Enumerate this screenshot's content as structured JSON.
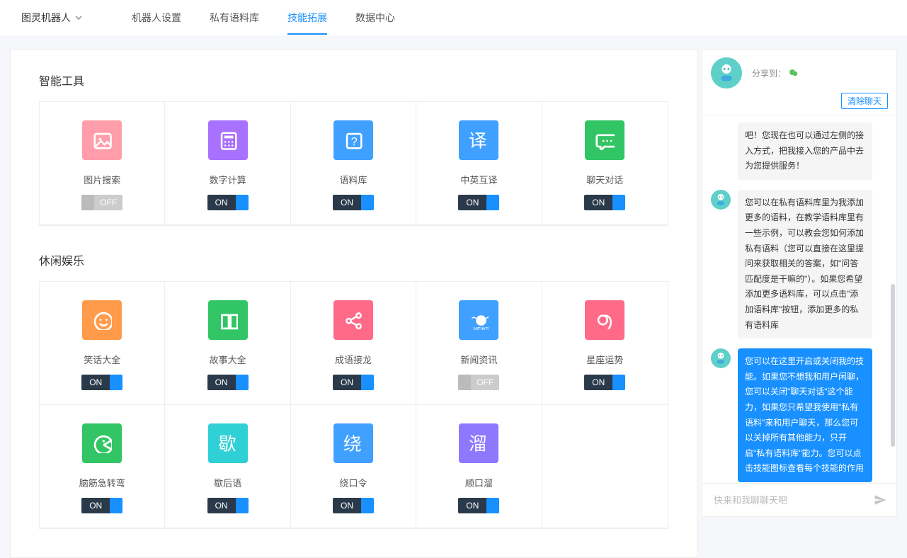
{
  "header": {
    "brand": "图灵机器人",
    "nav": [
      {
        "label": "机器人设置",
        "active": false
      },
      {
        "label": "私有语料库",
        "active": false
      },
      {
        "label": "技能拓展",
        "active": true
      },
      {
        "label": "数据中心",
        "active": false
      }
    ]
  },
  "toggle_labels": {
    "on": "ON",
    "off": "OFF"
  },
  "sections": {
    "tools": {
      "title": "智能工具",
      "items": [
        {
          "name": "image-search",
          "label": "图片搜索",
          "on": false,
          "color": "#ff9eaa",
          "icon": "image"
        },
        {
          "name": "number-calc",
          "label": "数字计算",
          "on": true,
          "color": "#a971ff",
          "icon": "calc"
        },
        {
          "name": "corpus",
          "label": "语料库",
          "on": true,
          "color": "#3fa0ff",
          "icon": "question"
        },
        {
          "name": "translate",
          "label": "中英互译",
          "on": true,
          "color": "#3fa0ff",
          "icon": "translate"
        },
        {
          "name": "chat",
          "label": "聊天对话",
          "on": true,
          "color": "#32c565",
          "icon": "chat"
        }
      ]
    },
    "fun": {
      "title": "休闲娱乐",
      "items": [
        {
          "name": "jokes",
          "label": "笑话大全",
          "on": true,
          "color": "#ff9b4a",
          "icon": "smile"
        },
        {
          "name": "stories",
          "label": "故事大全",
          "on": true,
          "color": "#32c565",
          "icon": "book"
        },
        {
          "name": "idiom",
          "label": "成语接龙",
          "on": true,
          "color": "#ff6a88",
          "icon": "share"
        },
        {
          "name": "news",
          "label": "新闻资讯",
          "on": false,
          "color": "#3fa0ff",
          "icon": "news"
        },
        {
          "name": "horoscope",
          "label": "星座运势",
          "on": true,
          "color": "#ff6a88",
          "icon": "zodiac"
        },
        {
          "name": "brain",
          "label": "脑筋急转弯",
          "on": true,
          "color": "#32c565",
          "icon": "pac"
        },
        {
          "name": "xiehouyu",
          "label": "歇后语",
          "on": true,
          "color": "#2fd0d6",
          "icon": "xie"
        },
        {
          "name": "tongue1",
          "label": "绕口令",
          "on": true,
          "color": "#3fa0ff",
          "icon": "rao"
        },
        {
          "name": "tongue2",
          "label": "顺口溜",
          "on": true,
          "color": "#8e78ff",
          "icon": "liu"
        }
      ]
    }
  },
  "chat": {
    "share_label": "分享到：",
    "clear_label": "清除聊天",
    "input_placeholder": "快来和我聊聊天吧",
    "messages": [
      {
        "type": "partial",
        "text": "吧！您现在也可以通过左侧的接入方式，把我接入您的产品中去为您提供服务！",
        "style": "plain",
        "avatar": false
      },
      {
        "type": "full",
        "text": "您可以在私有语料库里为我添加更多的语料，在教学语料库里有一些示例，可以教会您如何添加私有语料（您可以直接在这里提问来获取相关的答案，如\"问答匹配度是干嘛的\"）。如果您希望添加更多语料库，可以点击\"添加语料库\"按钮，添加更多的私有语料库",
        "style": "plain",
        "avatar": true
      },
      {
        "type": "full",
        "text": "您可以在这里开启或关闭我的技能。如果您不想我和用户闲聊，您可以关闭\"聊天对话\"这个能力，如果您只希望我使用\"私有语料\"来和用户聊天，那么您可以关掉所有其他能力，只开启\"私有语料库\"能力。您可以点击技能图标查看每个技能的作用",
        "style": "primary",
        "avatar": true
      }
    ]
  }
}
